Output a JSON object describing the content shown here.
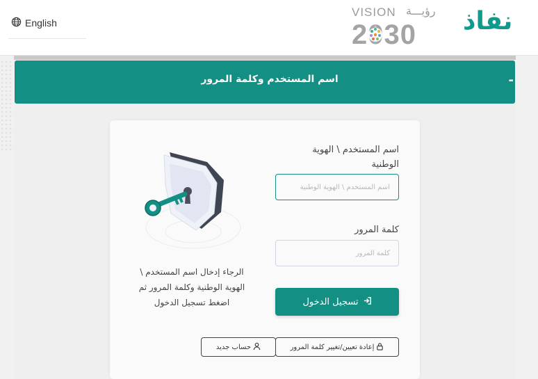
{
  "header": {
    "language_label": "English",
    "vision_word": "VISION",
    "vision_arabic": "رؤيـــة",
    "vision_year": "2030",
    "brand_name": "نفاذ"
  },
  "accordion": {
    "title": "اسم المستخدم وكلمة المرور",
    "toggle_symbol": "-"
  },
  "login_form": {
    "username_label": "اسم المستخدم \\ الهوية الوطنية",
    "username_placeholder": "اسم المستخدم \\ الهوية الوطنية",
    "username_value": "",
    "password_label": "كلمة المرور",
    "password_placeholder": "كلمة المرور",
    "password_value": "",
    "login_button": "تسجيل الدخول",
    "reset_password_button": "إعادة تعيين/تغيير كلمة المرور",
    "new_account_button": "حساب جديد"
  },
  "help_text": "الرجاء إدخال اسم المستخدم \\ الهوية الوطنية وكلمة المرور ثم اضغط تسجيل الدخول",
  "colors": {
    "brand_green": "#138f84",
    "input_border": "#cfd3e2",
    "background": "#f1f1f1"
  },
  "icons": {
    "language": "globe-icon",
    "login": "sign-in-icon",
    "reset": "lock-icon",
    "new_account": "user-icon",
    "illustration": "shield-key-illustration"
  }
}
